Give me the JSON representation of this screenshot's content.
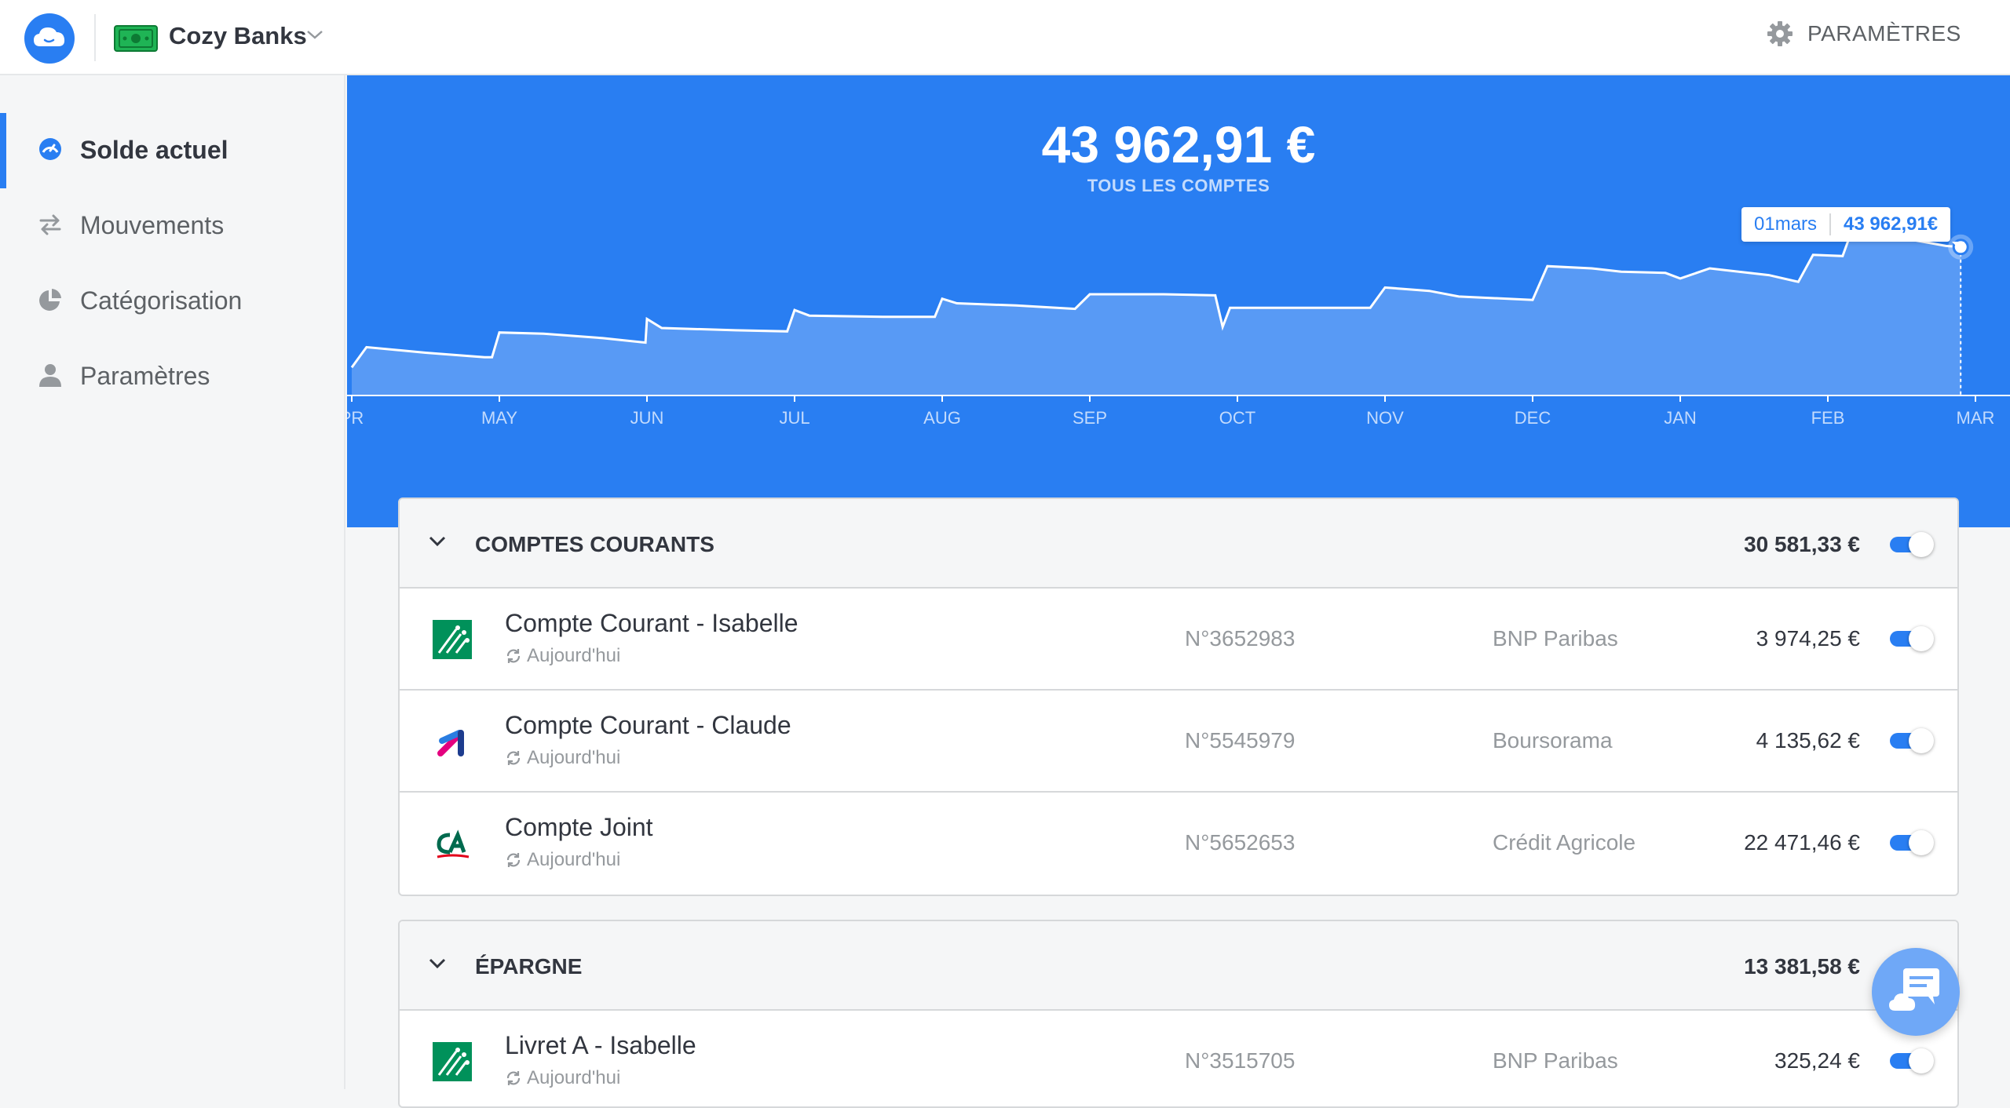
{
  "app": {
    "name": "Cozy Banks",
    "settings_label": "PARAMÈTRES"
  },
  "sidebar": {
    "items": [
      {
        "label": "Solde actuel",
        "icon": "gauge-icon",
        "active": true
      },
      {
        "label": "Mouvements",
        "icon": "transfer-arrows-icon",
        "active": false
      },
      {
        "label": "Catégorisation",
        "icon": "pie-chart-icon",
        "active": false
      },
      {
        "label": "Paramètres",
        "icon": "user-icon",
        "active": false
      }
    ]
  },
  "summary": {
    "balance": "43 962,91 €",
    "label": "TOUS LES COMPTES"
  },
  "tooltip": {
    "date": "01mars",
    "value": "43 962,91€"
  },
  "chart_data": {
    "type": "area",
    "x_ticks": [
      "PR",
      "MAY",
      "JUN",
      "JUL",
      "AUG",
      "SEP",
      "OCT",
      "NOV",
      "DEC",
      "JAN",
      "FEB",
      "MAR"
    ],
    "series": [
      {
        "values": [
          [
            0,
            26500
          ],
          [
            0.1,
            28300
          ],
          [
            0.5,
            27800
          ],
          [
            0.7,
            27600
          ],
          [
            0.9,
            27400
          ],
          [
            0.95,
            27400
          ],
          [
            1.0,
            29600
          ],
          [
            1.3,
            29500
          ],
          [
            1.7,
            29100
          ],
          [
            1.99,
            28700
          ],
          [
            2.0,
            30800
          ],
          [
            2.1,
            30000
          ],
          [
            2.6,
            29800
          ],
          [
            2.95,
            29700
          ],
          [
            3.0,
            31600
          ],
          [
            3.1,
            31100
          ],
          [
            3.6,
            31000
          ],
          [
            3.95,
            31000
          ],
          [
            4.0,
            32600
          ],
          [
            4.1,
            32200
          ],
          [
            4.5,
            32000
          ],
          [
            4.9,
            31700
          ],
          [
            5.0,
            33000
          ],
          [
            5.5,
            33000
          ],
          [
            5.85,
            32900
          ],
          [
            5.9,
            30100
          ],
          [
            5.95,
            31800
          ],
          [
            6.9,
            31800
          ],
          [
            7.0,
            33600
          ],
          [
            7.3,
            33300
          ],
          [
            7.5,
            32800
          ],
          [
            8.0,
            32500
          ],
          [
            8.1,
            35500
          ],
          [
            8.4,
            35300
          ],
          [
            8.6,
            35000
          ],
          [
            8.9,
            34900
          ],
          [
            9.0,
            34400
          ],
          [
            9.2,
            35300
          ],
          [
            9.6,
            34700
          ],
          [
            9.8,
            34100
          ],
          [
            9.9,
            36500
          ],
          [
            10.1,
            36400
          ],
          [
            10.15,
            38200
          ],
          [
            10.5,
            38000
          ],
          [
            10.8,
            37300
          ],
          [
            10.9,
            37200
          ]
        ]
      }
    ],
    "ylim": [
      24000,
      42000
    ],
    "grid": false
  },
  "groups": [
    {
      "title": "COMPTES COURANTS",
      "total": "30 581,33 €",
      "accounts": [
        {
          "name": "Compte Courant - Isabelle",
          "sync": "Aujourd'hui",
          "number": "N°3652983",
          "bank": "BNP Paribas",
          "balance": "3 974,25  €",
          "logo": "bnp-logo"
        },
        {
          "name": "Compte Courant - Claude",
          "sync": "Aujourd'hui",
          "number": "N°5545979",
          "bank": "Boursorama",
          "balance": "4 135,62  €",
          "logo": "boursorama-logo"
        },
        {
          "name": "Compte Joint",
          "sync": "Aujourd'hui",
          "number": "N°5652653",
          "bank": "Crédit Agricole",
          "balance": "22 471,46  €",
          "logo": "credit-agricole-logo"
        }
      ]
    },
    {
      "title": "ÉPARGNE",
      "total": "13 381,58 €",
      "accounts": [
        {
          "name": "Livret A - Isabelle",
          "sync": "Aujourd'hui",
          "number": "N°3515705",
          "bank": "BNP Paribas",
          "balance": "325,24  €",
          "logo": "bnp-logo"
        }
      ]
    }
  ],
  "colors": {
    "primary": "#297ef2",
    "text": "#32363f",
    "muted": "#95999d"
  }
}
